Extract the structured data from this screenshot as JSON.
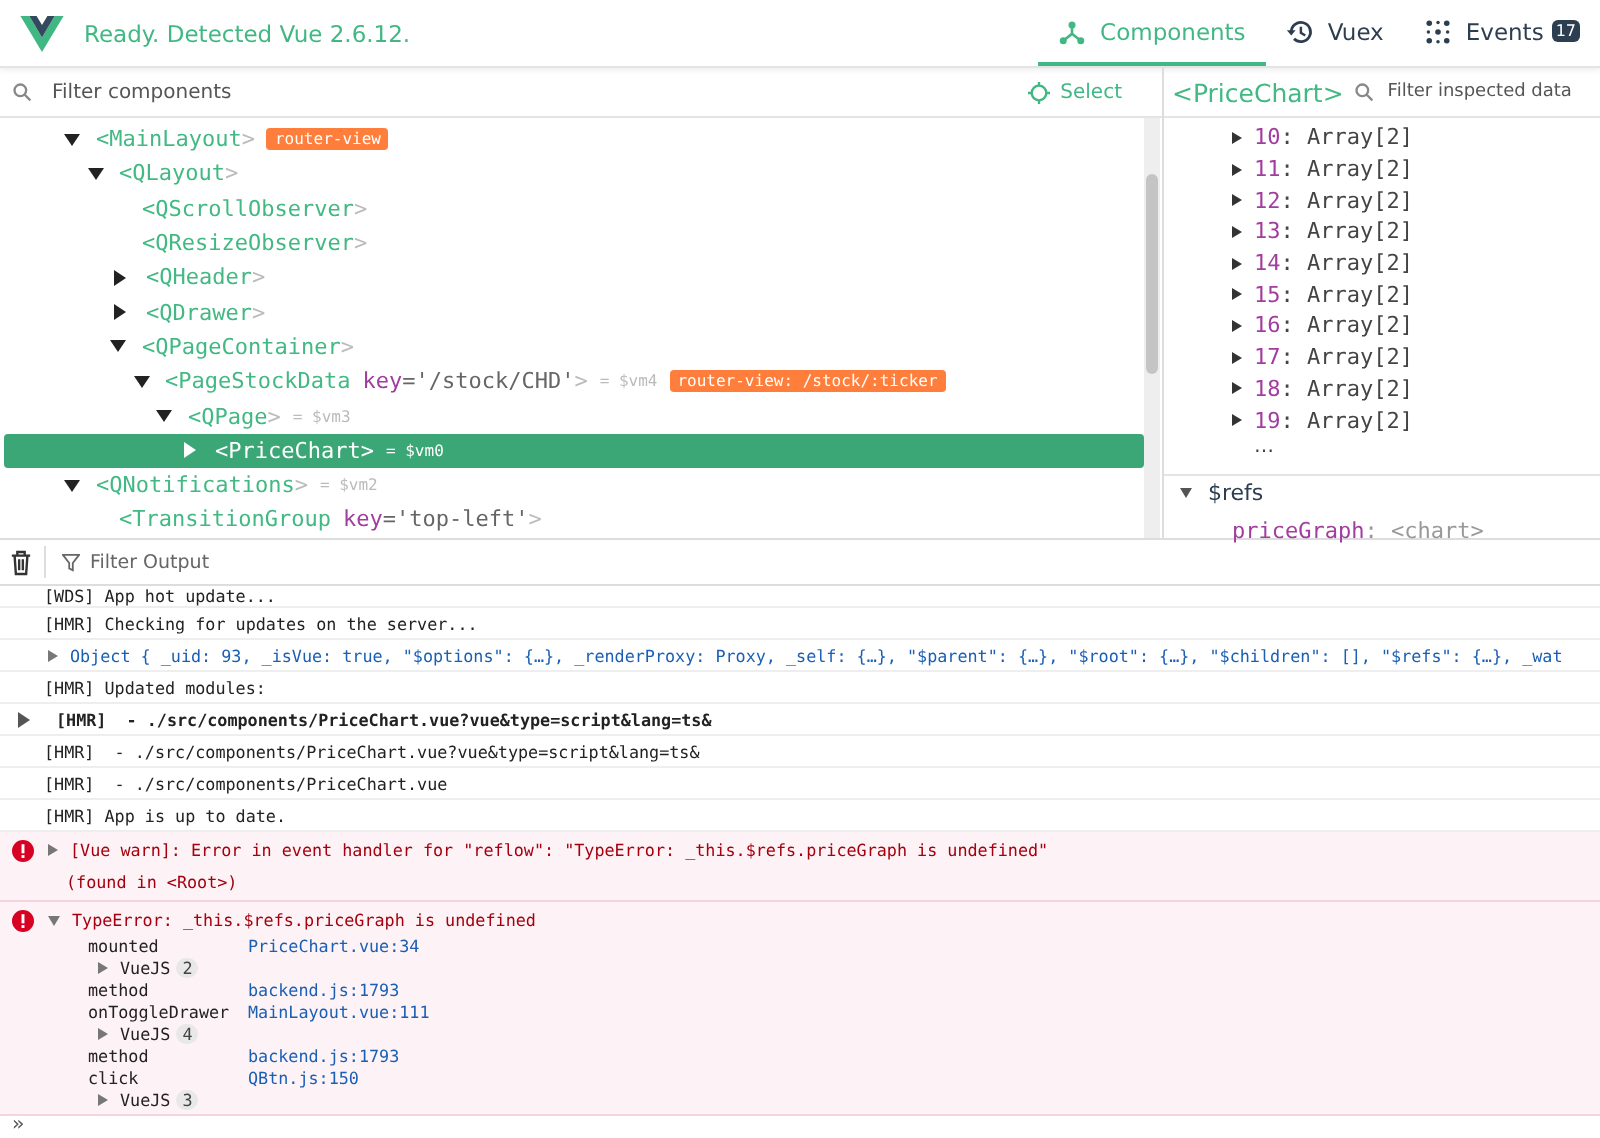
{
  "header": {
    "status": "Ready. Detected Vue 2.6.12.",
    "tabs": [
      {
        "label": "Components",
        "selected": true
      },
      {
        "label": "Vuex",
        "selected": false
      },
      {
        "label": "Events",
        "selected": false,
        "badge": "17"
      }
    ]
  },
  "tree_panel": {
    "search": {
      "placeholder": "Filter components"
    },
    "select_button": "Select",
    "nodes": [
      {
        "tag": "<MainLayout",
        "end": ">",
        "badge": "router-view",
        "expanded": true,
        "selected": false,
        "children": [
          {
            "tag": "<QLayout",
            "end": ">",
            "expanded": true,
            "selected": false,
            "children": [
              {
                "tag": "<QScrollObserver",
                "end": ">",
                "selected": false
              },
              {
                "tag": "<QResizeObserver",
                "end": ">",
                "selected": false
              },
              {
                "tag": "<QHeader",
                "end": ">",
                "expanded": false,
                "selected": false
              },
              {
                "tag": "<QDrawer",
                "end": ">",
                "expanded": false,
                "selected": false
              },
              {
                "tag": "<QPageContainer",
                "end": ">",
                "expanded": true,
                "selected": false,
                "children": [
                  {
                    "tag": "<PageStockData",
                    "attr_name": "key",
                    "attr_value": "='/stock/CHD'",
                    "end": ">",
                    "ref": "= $vm4",
                    "badge": "router-view: /stock/:ticker",
                    "expanded": true,
                    "selected": false,
                    "children": [
                      {
                        "tag": "<QPage",
                        "end": ">",
                        "ref": "= $vm3",
                        "expanded": true,
                        "selected": false,
                        "children": [
                          {
                            "tag": "<PriceChart",
                            "end": ">",
                            "ref": "= $vm0",
                            "expanded": false,
                            "selected": true
                          }
                        ]
                      }
                    ]
                  }
                ]
              }
            ]
          }
        ]
      },
      {
        "tag": "<QNotifications",
        "end": ">",
        "ref": "= $vm2",
        "expanded": true,
        "selected": false,
        "children": [
          {
            "tag": "<TransitionGroup",
            "attr_name": "key",
            "attr_value": "='top-left'",
            "end": ">",
            "selected": false
          }
        ]
      }
    ]
  },
  "inspector": {
    "title": "<PriceChart>",
    "search": {
      "placeholder": "Filter inspected data"
    },
    "entries": [
      {
        "key": "10",
        "value": ": Array[2]",
        "expanded": false
      },
      {
        "key": "11",
        "value": ": Array[2]",
        "expanded": false
      },
      {
        "key": "12",
        "value": ": Array[2]",
        "expanded": false
      },
      {
        "key": "13",
        "value": ": Array[2]",
        "expanded": false
      },
      {
        "key": "14",
        "value": ": Array[2]",
        "expanded": false
      },
      {
        "key": "15",
        "value": ": Array[2]",
        "expanded": false
      },
      {
        "key": "16",
        "value": ": Array[2]",
        "expanded": false
      },
      {
        "key": "17",
        "value": ": Array[2]",
        "expanded": false
      },
      {
        "key": "18",
        "value": ": Array[2]",
        "expanded": false
      },
      {
        "key": "19",
        "value": ": Array[2]",
        "expanded": false
      }
    ],
    "more": "…",
    "section": {
      "title": "$refs",
      "expanded": true,
      "rows": [
        {
          "key": "priceGraph",
          "value": ": <chart>"
        }
      ]
    }
  },
  "console": {
    "filter": {
      "placeholder": "Filter Output"
    },
    "entries": [
      {
        "kind": "log",
        "text": "[WDS] App hot update..."
      },
      {
        "kind": "log",
        "text": "[HMR] Checking for updates on the server..."
      },
      {
        "kind": "object",
        "text": "Object { _uid: 93, _isVue: true, \"$options\": {…}, _renderProxy: Proxy, _self: {…}, \"$parent\": {…}, \"$root\": {…}, \"$children\": [], \"$refs\": {…}, _wat",
        "expanded": false
      },
      {
        "kind": "log",
        "text": "[HMR] Updated modules:"
      },
      {
        "kind": "group",
        "text": "[HMR]  - ./src/components/PriceChart.vue?vue&type=script&lang=ts&",
        "expanded": false
      },
      {
        "kind": "log",
        "text": "[HMR]  - ./src/components/PriceChart.vue?vue&type=script&lang=ts&"
      },
      {
        "kind": "log",
        "text": "[HMR]  - ./src/components/PriceChart.vue"
      },
      {
        "kind": "log",
        "text": "[HMR] App is up to date."
      },
      {
        "kind": "error",
        "text": "[Vue warn]: Error in event handler for \"reflow\": \"TypeError: _this.$refs.priceGraph is undefined\"",
        "note": "(found in <Root>)",
        "expanded": false
      },
      {
        "kind": "error",
        "text": "TypeError: _this.$refs.priceGraph is undefined",
        "expanded": true,
        "stack": [
          {
            "kind": "frame",
            "fn": "mounted",
            "location": "PriceChart.vue:34"
          },
          {
            "kind": "group",
            "label": "VueJS",
            "count": "2",
            "expanded": false
          },
          {
            "kind": "frame",
            "fn": "method",
            "location": "backend.js:1793"
          },
          {
            "kind": "frame",
            "fn": "onToggleDrawer",
            "location": "MainLayout.vue:111"
          },
          {
            "kind": "group",
            "label": "VueJS",
            "count": "4",
            "expanded": false
          },
          {
            "kind": "frame",
            "fn": "method",
            "location": "backend.js:1793"
          },
          {
            "kind": "frame",
            "fn": "click",
            "location": "QBtn.js:150"
          },
          {
            "kind": "group",
            "label": "VueJS",
            "count": "3",
            "expanded": false
          }
        ]
      }
    ],
    "prompt": "»"
  }
}
